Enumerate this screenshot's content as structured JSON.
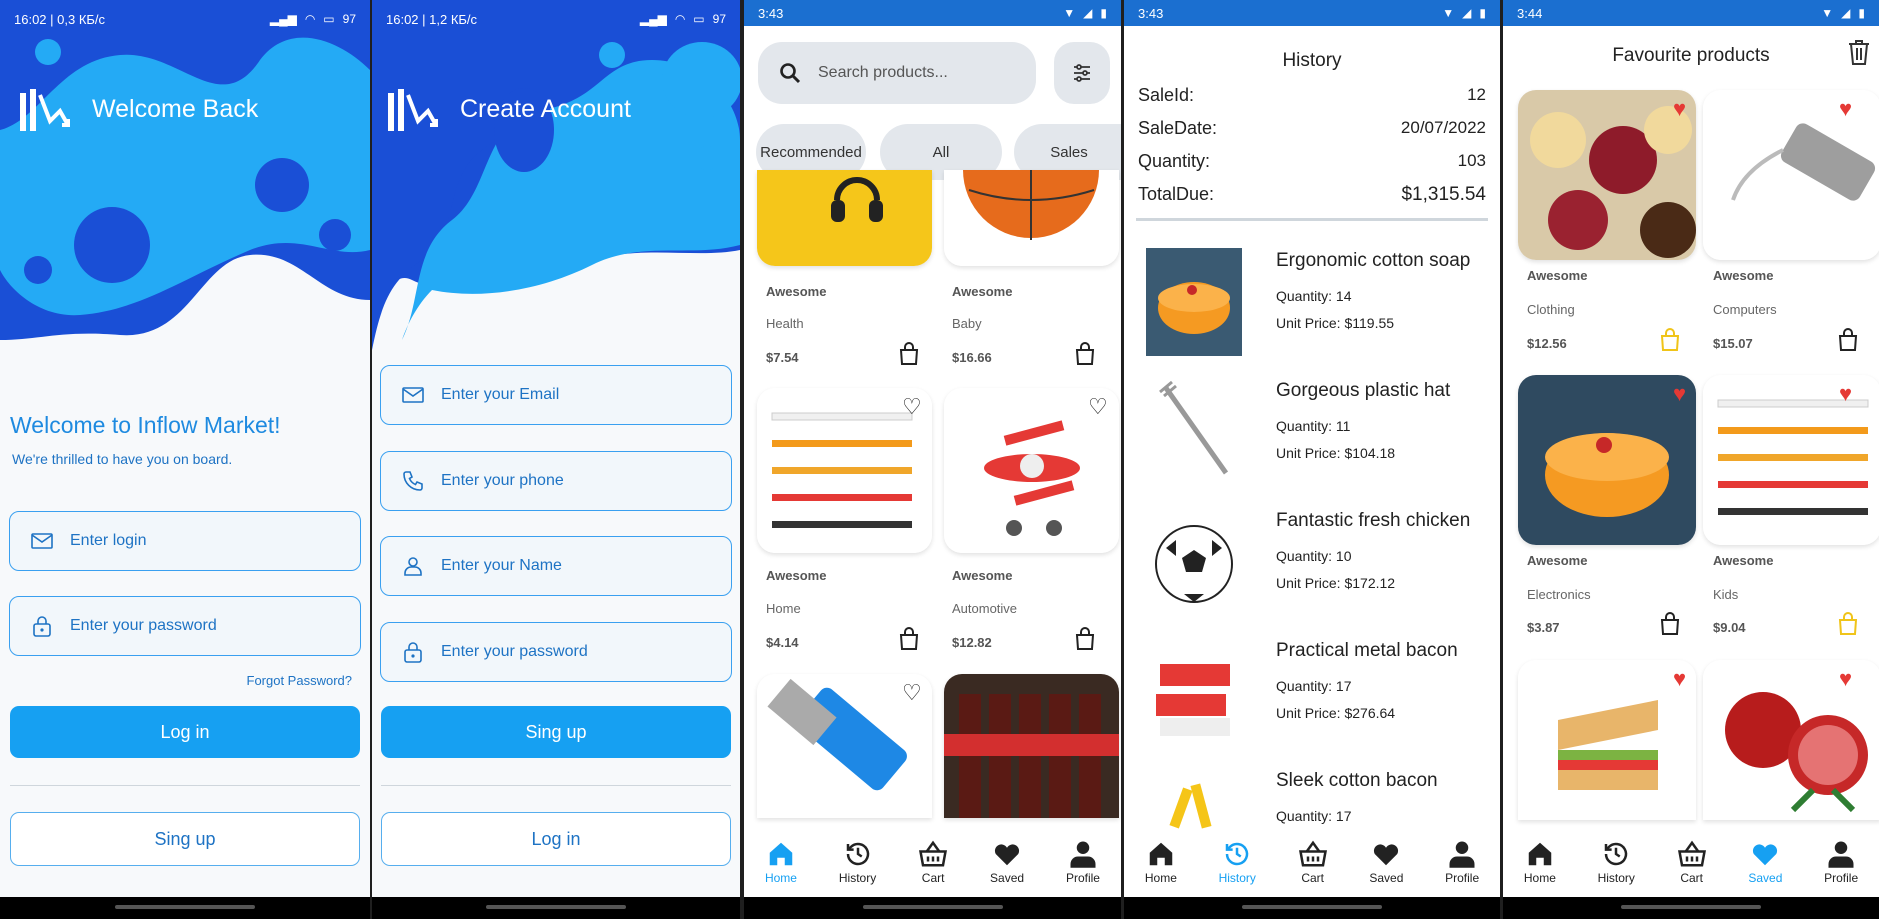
{
  "login": {
    "status_time": "16:02 | 0,3 КБ/с",
    "battery": "97",
    "title": "Welcome Back",
    "welcome": "Welcome to Inflow Market!",
    "subtitle": "We're thrilled to have you on board.",
    "login_placeholder": "Enter login",
    "password_placeholder": "Enter your password",
    "forgot": "Forgot Password?",
    "login_btn": "Log in",
    "signup_btn": "Sing up"
  },
  "register": {
    "status_time": "16:02 | 1,2 КБ/с",
    "battery": "97",
    "title": "Create Account",
    "email": "Enter your Email",
    "phone": "Enter your phone",
    "name": "Enter your Name",
    "password": "Enter your password",
    "signup_btn": "Sing up",
    "login_btn": "Log in"
  },
  "home": {
    "status_time": "3:43",
    "search_placeholder": "Search products...",
    "chips": [
      "Recommended",
      "All",
      "Sales"
    ],
    "products": [
      {
        "label": "Awesome",
        "category": "Health",
        "price": "$7.54"
      },
      {
        "label": "Awesome",
        "category": "Baby",
        "price": "$16.66"
      },
      {
        "label": "Awesome",
        "category": "Home",
        "price": "$4.14"
      },
      {
        "label": "Awesome",
        "category": "Automotive",
        "price": "$12.82"
      }
    ]
  },
  "history": {
    "status_time": "3:43",
    "title": "History",
    "sale_id_label": "SaleId:",
    "sale_id": "12",
    "sale_date_label": "SaleDate:",
    "sale_date": "20/07/2022",
    "quantity_label": "Quantity:",
    "quantity": "103",
    "total_label": "TotalDue:",
    "total": "$1,315.54",
    "items": [
      {
        "name": "Ergonomic cotton soap",
        "qty": "Quantity: 14",
        "price": "Unit Price: $119.55"
      },
      {
        "name": "Gorgeous plastic hat",
        "qty": "Quantity: 11",
        "price": "Unit Price: $104.18"
      },
      {
        "name": "Fantastic fresh chicken",
        "qty": "Quantity: 10",
        "price": "Unit Price: $172.12"
      },
      {
        "name": "Practical metal bacon",
        "qty": "Quantity: 17",
        "price": "Unit Price: $276.64"
      },
      {
        "name": "Sleek cotton bacon",
        "qty": "Quantity: 17",
        "price": ""
      }
    ]
  },
  "favourites": {
    "status_time": "3:44",
    "title": "Favourite products",
    "products": [
      {
        "label": "Awesome",
        "category": "Clothing",
        "price": "$12.56"
      },
      {
        "label": "Awesome",
        "category": "Computers",
        "price": "$15.07"
      },
      {
        "label": "Awesome",
        "category": "Electronics",
        "price": "$3.87"
      },
      {
        "label": "Awesome",
        "category": "Kids",
        "price": "$9.04"
      }
    ]
  },
  "nav": {
    "home": "Home",
    "history": "History",
    "cart": "Cart",
    "saved": "Saved",
    "profile": "Profile"
  },
  "colors": {
    "accent": "#16a0f2",
    "deep_blue": "#1a4fd6",
    "heart_red": "#e53935"
  }
}
